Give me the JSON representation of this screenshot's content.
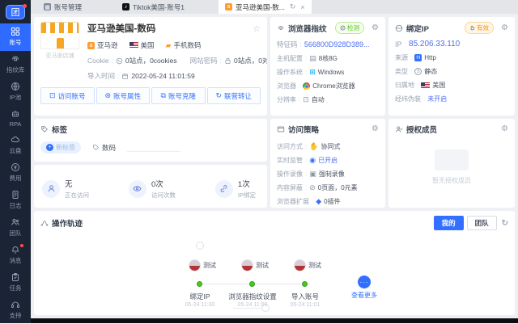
{
  "app": {
    "logo_text": "团",
    "tabs": [
      {
        "label": "账号管理"
      },
      {
        "label": "Tiktok美国-账号1"
      },
      {
        "label": "亚马逊美国-数...",
        "active": true
      }
    ]
  },
  "sidebar": {
    "items": [
      {
        "label": "账号"
      },
      {
        "label": "指纹库"
      },
      {
        "label": "IP池"
      },
      {
        "label": "RPA"
      },
      {
        "label": "云盘"
      },
      {
        "label": "费用"
      },
      {
        "label": "日志"
      },
      {
        "label": "团队"
      }
    ],
    "bottom": [
      {
        "label": "消息"
      },
      {
        "label": "任务"
      },
      {
        "label": "支持"
      }
    ]
  },
  "account": {
    "title": "亚马逊美国-数码",
    "platform_caption": "亚马逊店铺",
    "tags": [
      {
        "label": "亚马逊"
      },
      {
        "label": "美国"
      },
      {
        "label": "手机数码"
      }
    ],
    "cookie_label": "Cookie",
    "cookie_value": "0站点，0cookies",
    "password_label": "网站密码",
    "password_value": "0站点，0对",
    "import_label": "导入时间",
    "import_value": "2022-05-24 11:01:59",
    "actions": [
      {
        "label": "访问账号"
      },
      {
        "label": "账号属性"
      },
      {
        "label": "账号克隆"
      },
      {
        "label": "联营转让"
      }
    ]
  },
  "tags_card": {
    "title": "标签",
    "new_tag_label": "新标签",
    "tag": "数码"
  },
  "stats": {
    "items": [
      {
        "value": "无",
        "label": "正在访问"
      },
      {
        "value": "0次",
        "label": "访问次数"
      },
      {
        "value": "1次",
        "label": "IP绑定"
      }
    ]
  },
  "fingerprint": {
    "title": "浏览器指纹",
    "badge": "检测",
    "code_label": "特征码",
    "code_value": "566800D928D389...",
    "rows": [
      {
        "label": "主机配置",
        "value": "8核8G"
      },
      {
        "label": "操作系统",
        "value": "Windows"
      },
      {
        "label": "浏览器",
        "value": "Chrome浏览器"
      },
      {
        "label": "分辨率",
        "value": "自动"
      }
    ]
  },
  "ip": {
    "title": "绑定IP",
    "badge": "有效",
    "ip_label": "IP",
    "ip_value": "85.206.33.110",
    "rows": [
      {
        "label": "来源",
        "value": "Http"
      },
      {
        "label": "类型",
        "value": "静态"
      },
      {
        "label": "归属地",
        "value": "美国"
      },
      {
        "label": "经纬伪装",
        "value": "未开启"
      }
    ]
  },
  "policy": {
    "title": "访问策略",
    "rows": [
      {
        "label": "访问方式",
        "value": "协同式"
      },
      {
        "label": "实时监管",
        "value": "已开启"
      },
      {
        "label": "操作录像",
        "value": "强制录像"
      },
      {
        "label": "内容屏蔽",
        "value": "0页面，0元素"
      },
      {
        "label": "浏览器扩展",
        "value": "0插件"
      }
    ]
  },
  "members": {
    "title": "授权成员",
    "empty_text": "暂无授权成员"
  },
  "trail": {
    "title": "操作轨迹",
    "my_button": "我的",
    "team_button": "团队",
    "view_more": "查看更多",
    "steps": [
      {
        "user": "测试",
        "name": "绑定IP",
        "time": "05-24 11:00"
      },
      {
        "user": "测试",
        "name": "浏览器指纹设置",
        "time": "05-24 11:00"
      },
      {
        "user": "测试",
        "name": "导入账号",
        "time": "05-24 11:01"
      }
    ]
  },
  "colors": {
    "primary": "#3370ff",
    "success": "#52c41a",
    "warning": "#fa8c16",
    "sidebar_bg": "#1b2434"
  }
}
